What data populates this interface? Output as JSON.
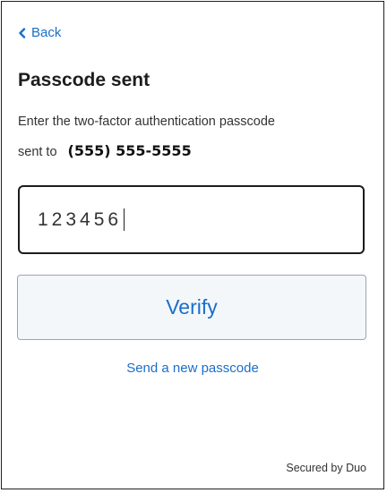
{
  "nav": {
    "back_label": "Back"
  },
  "header": {
    "title": "Passcode sent"
  },
  "instructions": {
    "text_line1": "Enter the two-factor authentication passcode",
    "text_line2": "sent to",
    "phone_number": "(555) 555-5555"
  },
  "passcode_input": {
    "value": "123456"
  },
  "verify_button": {
    "label": "Verify"
  },
  "resend_link": {
    "label": "Send a new passcode"
  },
  "footer": {
    "secured_by": "Secured by Duo"
  },
  "colors": {
    "link": "#1a6fc9",
    "button_bg": "#f4f7fa",
    "border_dark": "#1c1c1c"
  },
  "icons": {
    "back": "chevron-left-icon"
  }
}
